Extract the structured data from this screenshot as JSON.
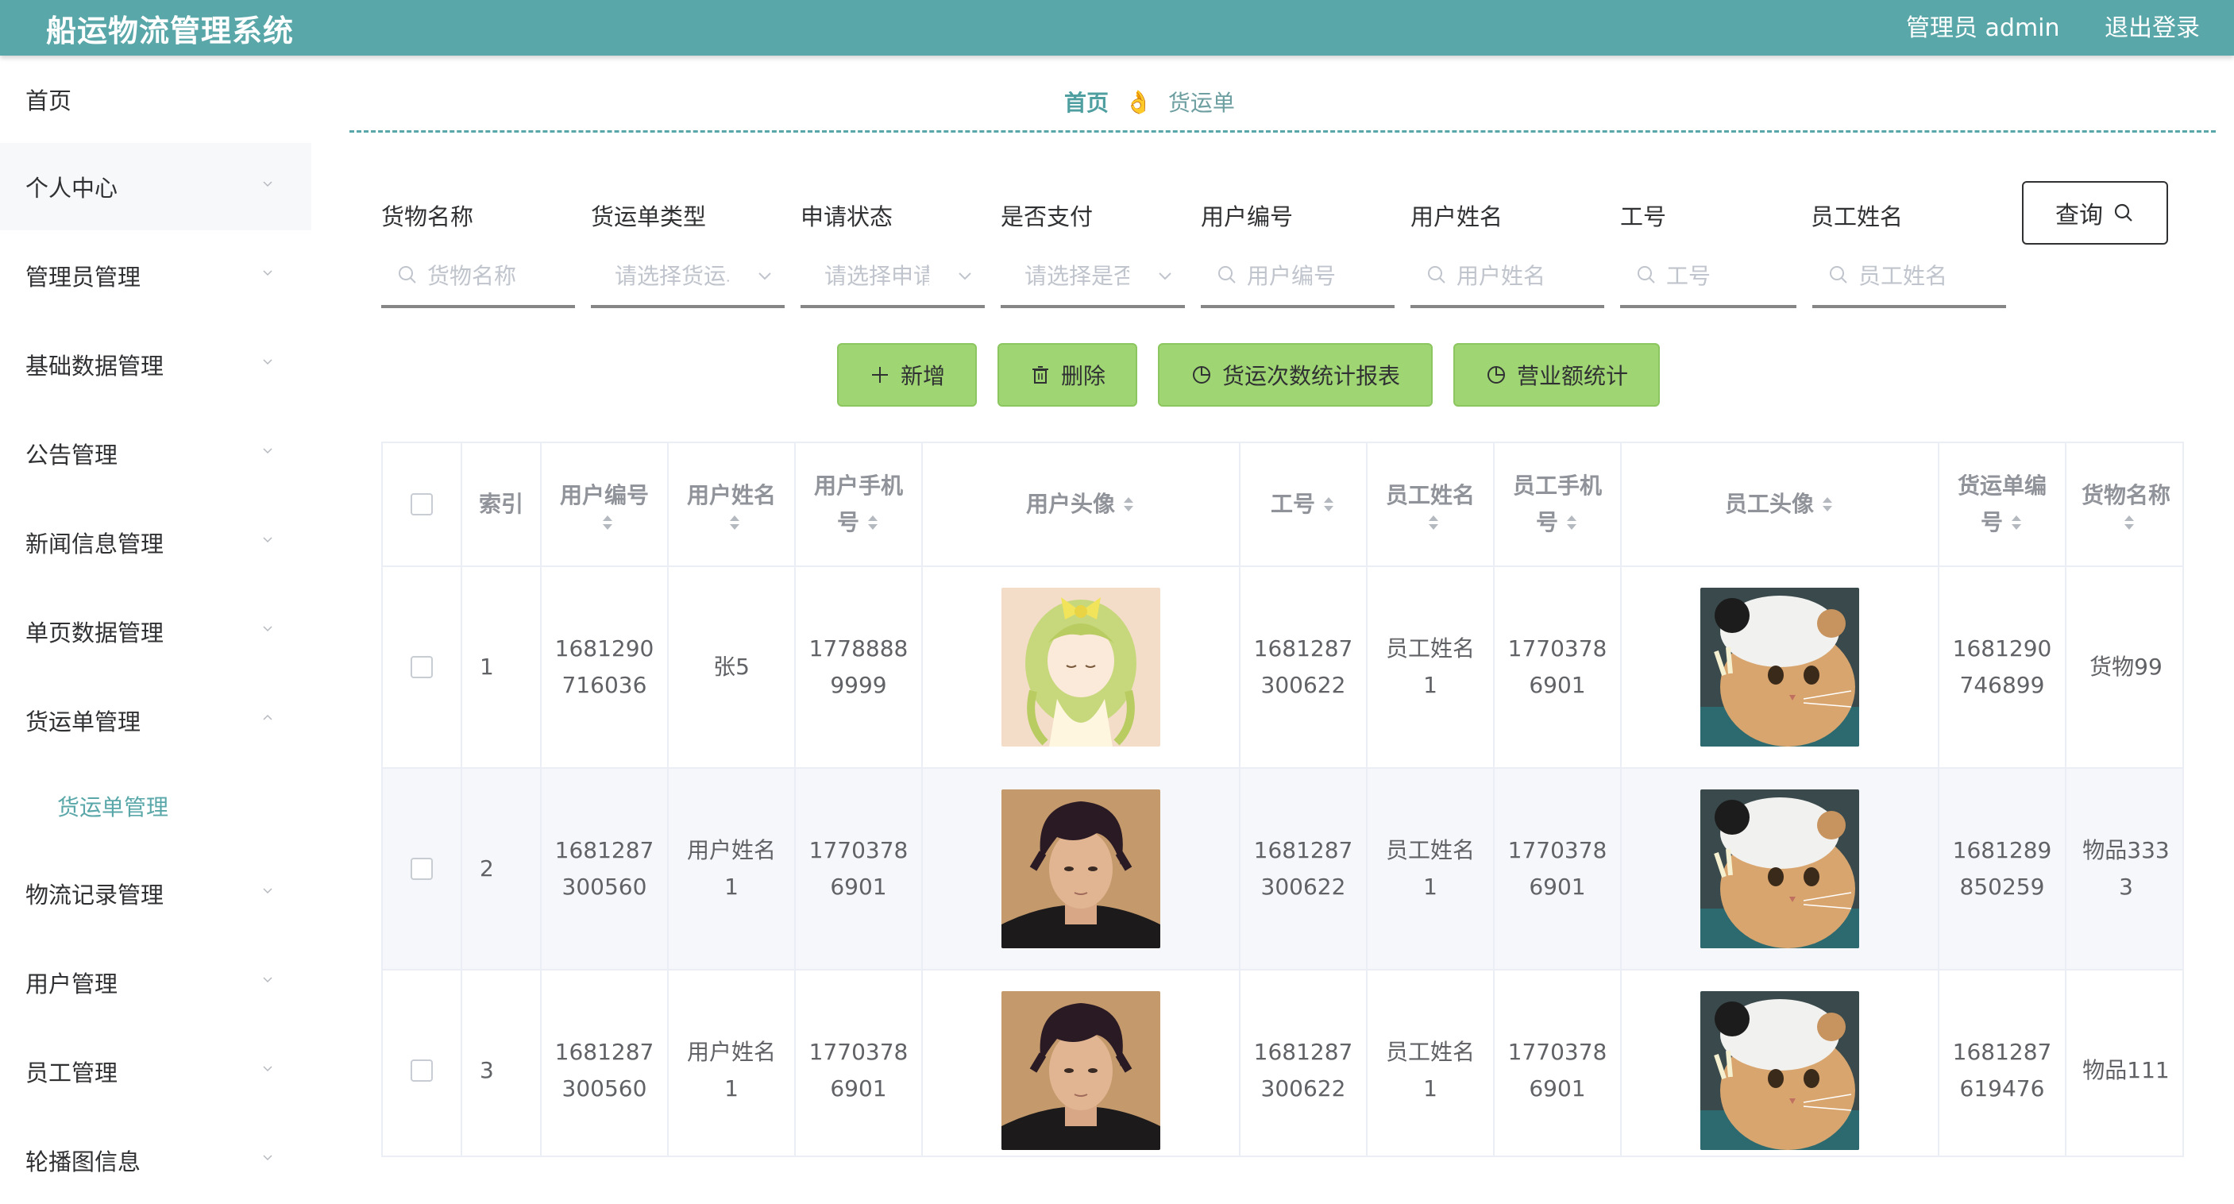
{
  "header": {
    "title": "船运物流管理系统",
    "user": "管理员 admin",
    "logout": "退出登录"
  },
  "sidebar": {
    "items": [
      {
        "label": "首页"
      },
      {
        "label": "个人中心"
      },
      {
        "label": "管理员管理"
      },
      {
        "label": "基础数据管理"
      },
      {
        "label": "公告管理"
      },
      {
        "label": "新闻信息管理"
      },
      {
        "label": "单页数据管理"
      },
      {
        "label": "货运单管理",
        "sub": "货运单管理"
      },
      {
        "label": "物流记录管理"
      },
      {
        "label": "用户管理"
      },
      {
        "label": "员工管理"
      },
      {
        "label": "轮播图信息"
      }
    ]
  },
  "breadcrumb": {
    "home": "首页",
    "separator": "👌",
    "current": "货运单"
  },
  "search": {
    "labels": [
      "货物名称",
      "货运单类型",
      "申请状态",
      "是否支付",
      "用户编号",
      "用户姓名",
      "工号",
      "员工姓名"
    ],
    "placeholders": [
      "货物名称",
      "请选择货运单类型",
      "请选择申请状态",
      "请选择是否支付",
      "用户编号",
      "用户姓名",
      "工号",
      "员工姓名"
    ],
    "query_button": "查询"
  },
  "actions": {
    "add": "新增",
    "delete": "删除",
    "stats_count": "货运次数统计报表",
    "stats_revenue": "营业额统计"
  },
  "table": {
    "headers": {
      "index": "索引",
      "user_no": [
        "用户编号"
      ],
      "user_name": [
        "用户姓名"
      ],
      "user_phone": [
        "用户手机",
        "号"
      ],
      "user_avatar": [
        "用户头像"
      ],
      "staff_no": [
        "工号"
      ],
      "staff_name": [
        "员工姓名"
      ],
      "staff_phone": [
        "员工手机",
        "号"
      ],
      "staff_avatar": [
        "员工头像"
      ],
      "order_no": [
        "货运单编",
        "号"
      ],
      "goods_name": [
        "货物名称"
      ]
    },
    "rows": [
      {
        "index": "1",
        "user_no": [
          "1681290",
          "716036"
        ],
        "user_name": [
          "张5"
        ],
        "user_phone": [
          "1778888",
          "9999"
        ],
        "user_avatar": "anime-girl-avatar",
        "staff_no": [
          "1681287",
          "300622"
        ],
        "staff_name": [
          "员工姓名",
          "1"
        ],
        "staff_phone": [
          "1770378",
          "6901"
        ],
        "staff_avatar": "cat-avatar",
        "order_no": [
          "1681290",
          "746899"
        ],
        "goods_name": [
          "货物99"
        ]
      },
      {
        "index": "2",
        "user_no": [
          "1681287",
          "300560"
        ],
        "user_name": [
          "用户姓名",
          "1"
        ],
        "user_phone": [
          "1770378",
          "6901"
        ],
        "user_avatar": "man-avatar",
        "staff_no": [
          "1681287",
          "300622"
        ],
        "staff_name": [
          "员工姓名",
          "1"
        ],
        "staff_phone": [
          "1770378",
          "6901"
        ],
        "staff_avatar": "cat-avatar",
        "order_no": [
          "1681289",
          "850259"
        ],
        "goods_name": [
          "物品333",
          "3"
        ]
      },
      {
        "index": "3",
        "user_no": [
          "1681287",
          "300560"
        ],
        "user_name": [
          "用户姓名",
          "1"
        ],
        "user_phone": [
          "1770378",
          "6901"
        ],
        "user_avatar": "man-avatar",
        "staff_no": [
          "1681287",
          "300622"
        ],
        "staff_name": [
          "员工姓名",
          "1"
        ],
        "staff_phone": [
          "1770378",
          "6901"
        ],
        "staff_avatar": "cat-avatar",
        "order_no": [
          "1681287",
          "619476"
        ],
        "goods_name": [
          "物品111"
        ]
      }
    ]
  },
  "colors": {
    "header": "#5aa7a9",
    "accent": "#5aa7a9",
    "button": "#9fd573",
    "stripe": "#f5f7fa"
  }
}
